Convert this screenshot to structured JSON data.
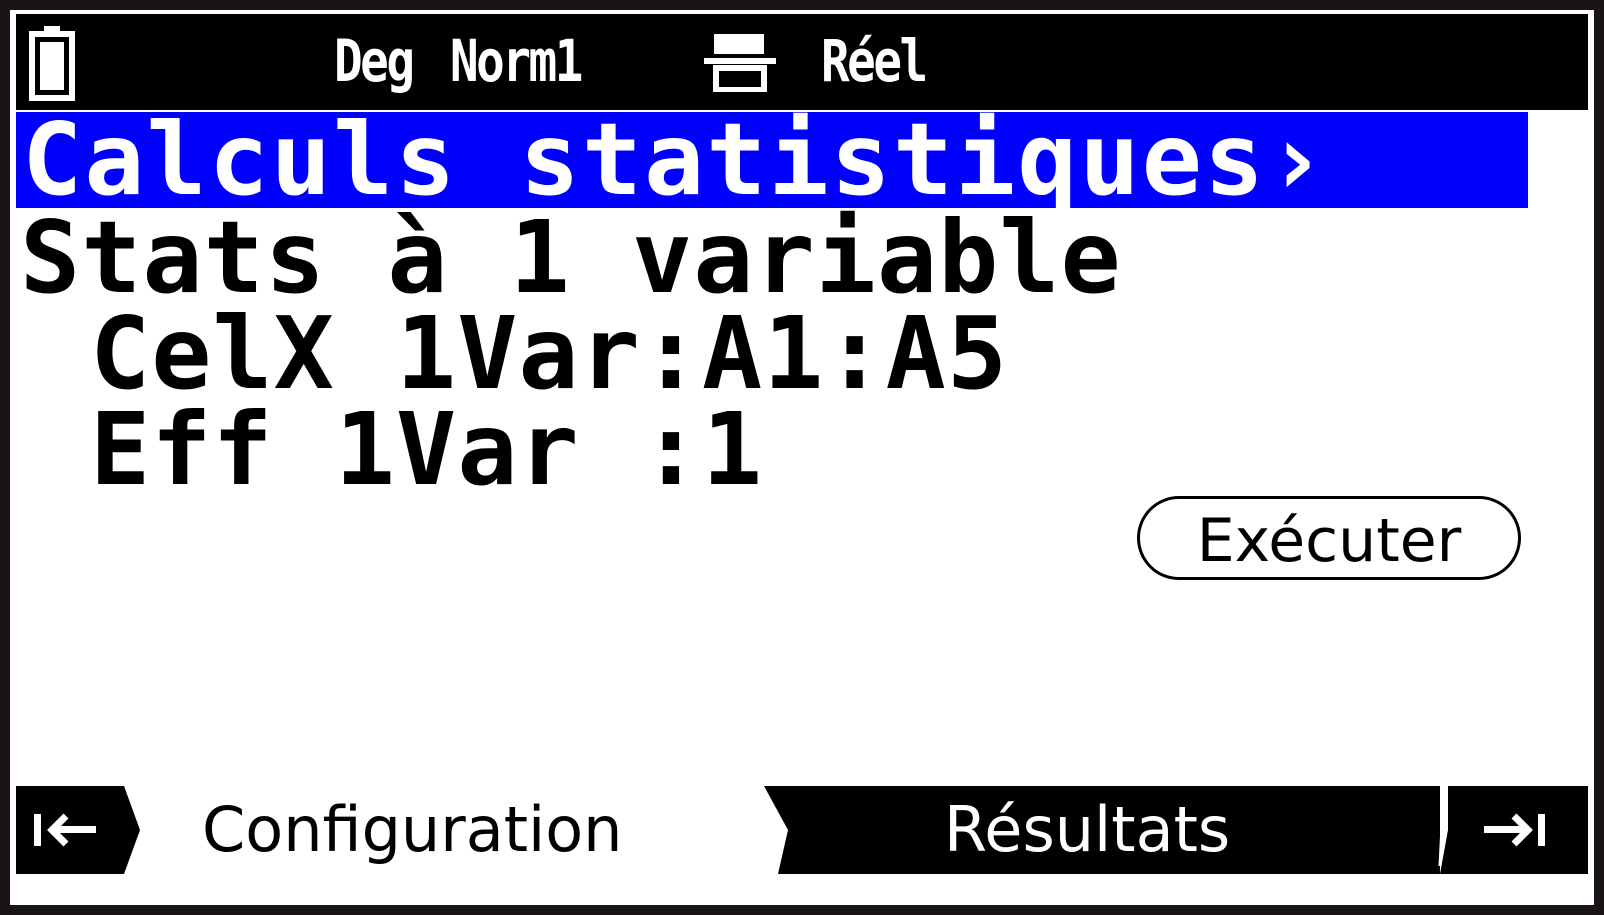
{
  "status_bar": {
    "angle_mode": "Deg",
    "number_format": "Norm1",
    "complex_mode": "Réel",
    "icons": [
      "battery-icon",
      "display-mode-icon"
    ]
  },
  "title": "Calculs statistiques›",
  "lines": {
    "mode": "Stats à 1 variable",
    "cell_range": "CelX 1Var:A1:A5",
    "frequency": "Eff 1Var :1"
  },
  "execute_button": {
    "label": "Exécuter"
  },
  "tabs": {
    "items": [
      {
        "label": "Configuration",
        "active": true
      },
      {
        "label": "Résultats",
        "active": false
      }
    ],
    "nav_icons": [
      "jump-first-icon",
      "jump-last-icon"
    ]
  },
  "colors": {
    "title_background": "#0000ff",
    "bar_background": "#000000",
    "screen_background": "#ffffff",
    "bezel": "#1a1414"
  }
}
